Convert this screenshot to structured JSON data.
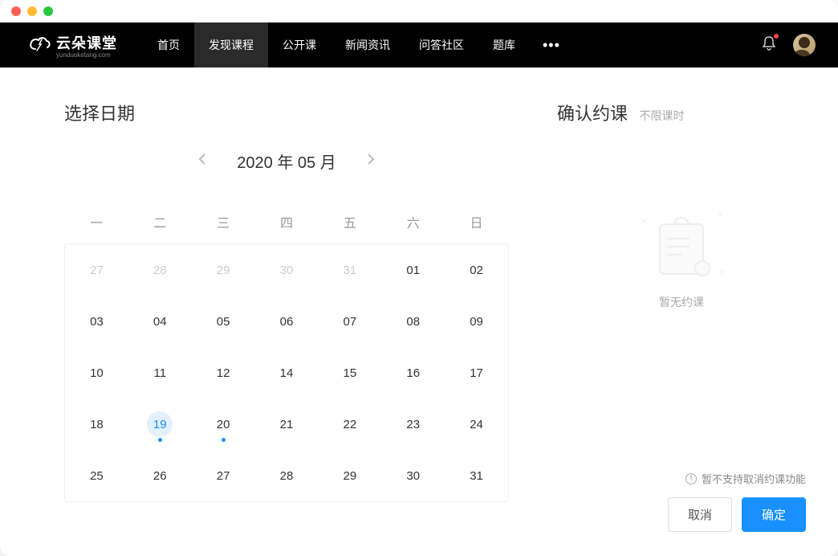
{
  "window": {
    "title": "云朵课堂"
  },
  "topbar": {
    "logo_text": "云朵课堂",
    "logo_sub": "yunduoketang.com",
    "nav": [
      {
        "label": "首页",
        "active": false
      },
      {
        "label": "发现课程",
        "active": true
      },
      {
        "label": "公开课",
        "active": false
      },
      {
        "label": "新闻资讯",
        "active": false
      },
      {
        "label": "问答社区",
        "active": false
      },
      {
        "label": "题库",
        "active": false
      }
    ]
  },
  "calendar": {
    "title": "选择日期",
    "month_label": "2020 年 05 月",
    "weekdays": [
      "一",
      "二",
      "三",
      "四",
      "五",
      "六",
      "日"
    ],
    "days": [
      {
        "d": "27",
        "muted": true
      },
      {
        "d": "28",
        "muted": true
      },
      {
        "d": "29",
        "muted": true
      },
      {
        "d": "30",
        "muted": true
      },
      {
        "d": "31",
        "muted": true
      },
      {
        "d": "01"
      },
      {
        "d": "02"
      },
      {
        "d": "03"
      },
      {
        "d": "04"
      },
      {
        "d": "05"
      },
      {
        "d": "06"
      },
      {
        "d": "07"
      },
      {
        "d": "08"
      },
      {
        "d": "09"
      },
      {
        "d": "10"
      },
      {
        "d": "11"
      },
      {
        "d": "12"
      },
      {
        "d": "14"
      },
      {
        "d": "15"
      },
      {
        "d": "16"
      },
      {
        "d": "17"
      },
      {
        "d": "18"
      },
      {
        "d": "19",
        "selected": true,
        "dot": true
      },
      {
        "d": "20",
        "dot": true
      },
      {
        "d": "21"
      },
      {
        "d": "22"
      },
      {
        "d": "23"
      },
      {
        "d": "24"
      },
      {
        "d": "25"
      },
      {
        "d": "26"
      },
      {
        "d": "27"
      },
      {
        "d": "28"
      },
      {
        "d": "29"
      },
      {
        "d": "30"
      },
      {
        "d": "31"
      }
    ]
  },
  "confirm": {
    "title": "确认约课",
    "subtitle": "不限课时",
    "empty_text": "暂无约课",
    "warning": "暂不支持取消约课功能",
    "cancel": "取消",
    "ok": "确定"
  }
}
